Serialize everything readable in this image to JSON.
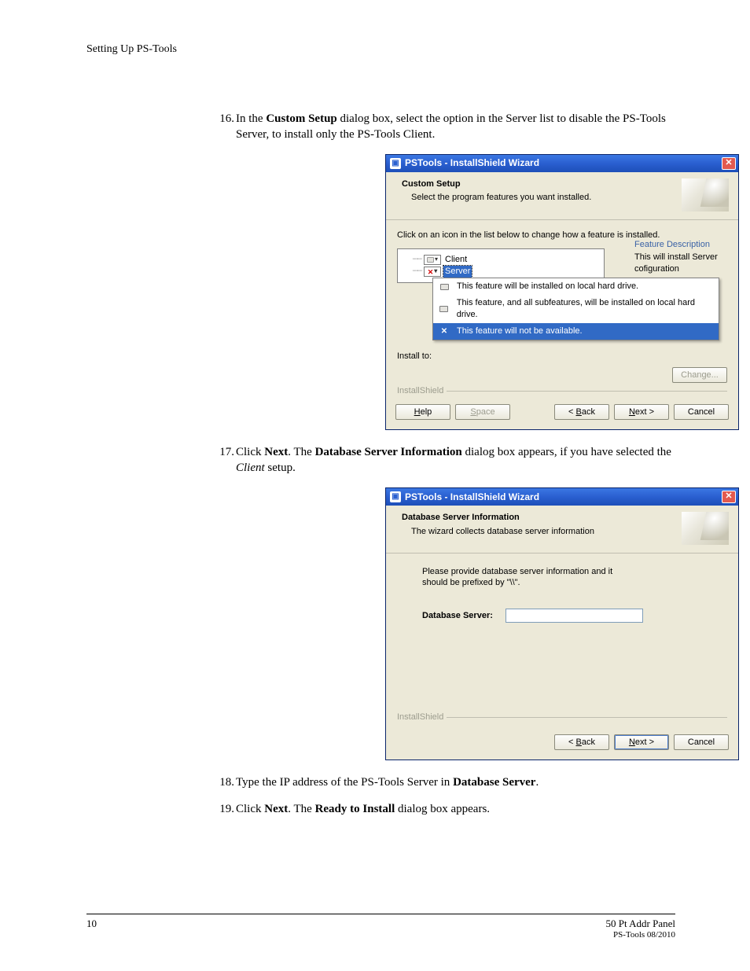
{
  "header": {
    "running": "Setting Up PS-Tools"
  },
  "steps": {
    "s16": {
      "num": "16.",
      "text_pre": "In the ",
      "b1": "Custom Setup",
      "text_mid": " dialog box, select the option in the Server list to disable the PS-Tools Server, to install only the PS-Tools Client."
    },
    "s17": {
      "num": "17.",
      "t1": "Click ",
      "b1": "Next",
      "t2": ". The ",
      "b2": "Database Server Information",
      "t3": " dialog box appears, if you have selected the ",
      "i1": "Client",
      "t4": " setup."
    },
    "s18": {
      "num": "18.",
      "t1": "Type the IP address of the PS-Tools Server in ",
      "b1": "Database Server",
      "t2": "."
    },
    "s19": {
      "num": "19.",
      "t1": "Click ",
      "b1": "Next",
      "t2": ". The ",
      "b2": "Ready to Install",
      "t3": " dialog box appears."
    }
  },
  "dialog1": {
    "title": "PSTools - InstallShield Wizard",
    "htitle": "Custom Setup",
    "hsub": "Select the program features you want installed.",
    "instr": "Click on an icon in the list below to change how a feature is installed.",
    "tree": {
      "client": "Client",
      "server": "Server"
    },
    "menu": {
      "m1": "This feature will be installed on local hard drive.",
      "m2": "This feature, and all subfeatures, will be installed on local hard drive.",
      "m3": "This feature will not be available."
    },
    "side": {
      "title": "Feature Description",
      "body": "This will install Server cofiguration"
    },
    "install_to": "Install to:",
    "change": "Change...",
    "installshield": "InstallShield",
    "buttons": {
      "help_pre": "H",
      "help": "elp",
      "space_pre": "S",
      "space": "pace",
      "back_pre": "< ",
      "back_u": "B",
      "back": "ack",
      "next_pre": "",
      "next_u": "N",
      "next": "ext >",
      "cancel": "Cancel"
    }
  },
  "dialog2": {
    "title": "PSTools - InstallShield Wizard",
    "htitle": "Database Server Information",
    "hsub": "The wizard collects database server information",
    "instr": "Please provide database server information and it should be prefixed by \"\\\\\".",
    "label": "Database Server:",
    "value": "",
    "installshield": "InstallShield",
    "buttons": {
      "back_pre": "< ",
      "back_u": "B",
      "back": "ack",
      "next_pre": "",
      "next_u": "N",
      "next": "ext >",
      "cancel": "Cancel"
    }
  },
  "footer": {
    "page": "10",
    "prod": "50 Pt Addr Panel",
    "rev": "PS-Tools 08/2010"
  }
}
